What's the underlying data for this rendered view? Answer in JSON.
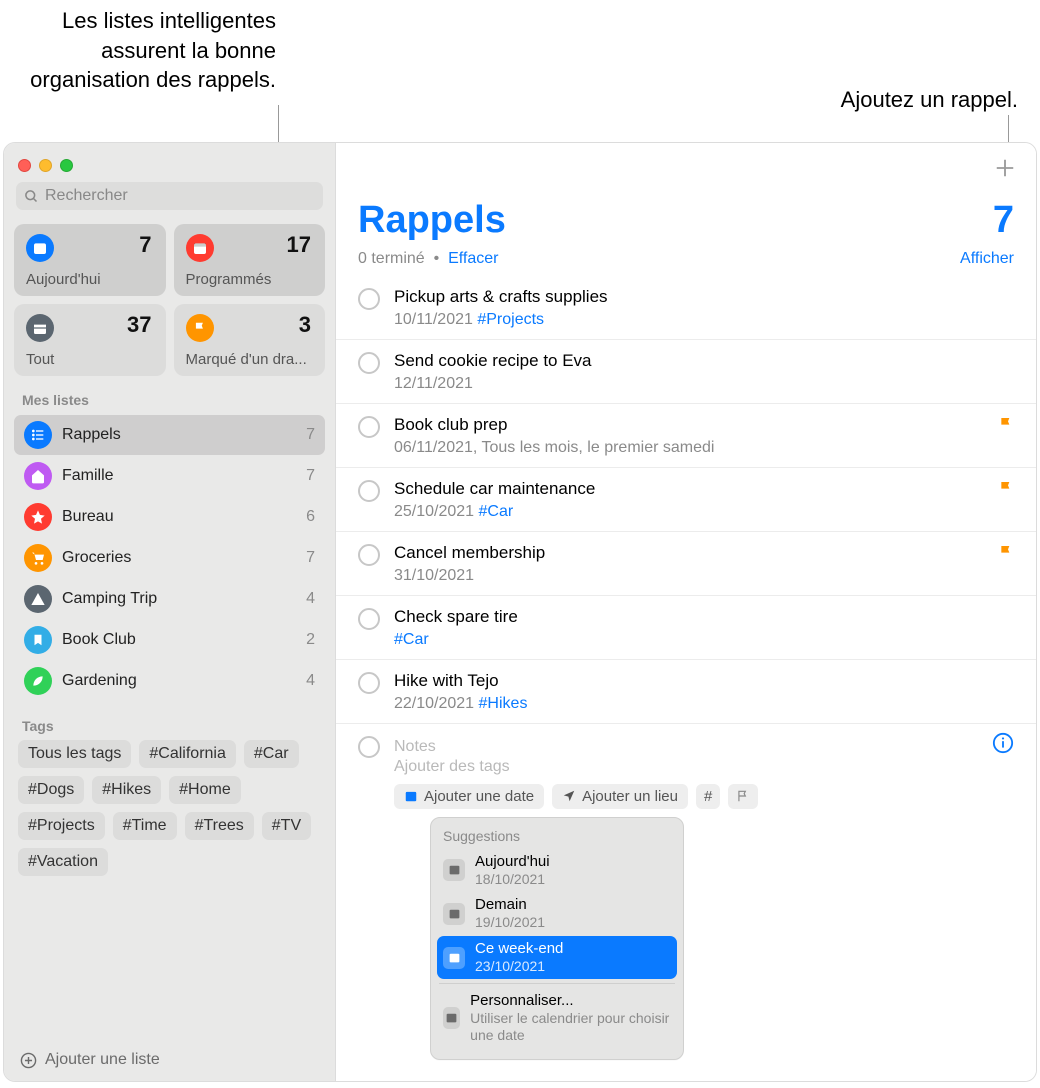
{
  "callouts": {
    "left": "Les listes intelligentes assurent la bonne organisation des rappels.",
    "right": "Ajoutez un rappel."
  },
  "search": {
    "placeholder": "Rechercher"
  },
  "smart": [
    {
      "id": "today",
      "label": "Aujourd'hui",
      "count": "7",
      "color": "#0a7aff"
    },
    {
      "id": "scheduled",
      "label": "Programmés",
      "count": "17",
      "color": "#ff3b30"
    },
    {
      "id": "all",
      "label": "Tout",
      "count": "37",
      "color": "#5b6670"
    },
    {
      "id": "flagged",
      "label": "Marqué d'un dra...",
      "count": "3",
      "color": "#ff9500"
    }
  ],
  "sections": {
    "lists": "Mes listes",
    "tags": "Tags"
  },
  "lists": [
    {
      "name": "Rappels",
      "count": "7",
      "color": "#0a7aff",
      "selected": true
    },
    {
      "name": "Famille",
      "count": "7",
      "color": "#bf5af2"
    },
    {
      "name": "Bureau",
      "count": "6",
      "color": "#ff3b30"
    },
    {
      "name": "Groceries",
      "count": "7",
      "color": "#ff9500"
    },
    {
      "name": "Camping Trip",
      "count": "4",
      "color": "#5b6670"
    },
    {
      "name": "Book Club",
      "count": "2",
      "color": "#32ade6"
    },
    {
      "name": "Gardening",
      "count": "4",
      "color": "#30d158"
    }
  ],
  "tags": [
    "Tous les tags",
    "#California",
    "#Car",
    "#Dogs",
    "#Hikes",
    "#Home",
    "#Projects",
    "#Time",
    "#Trees",
    "#TV",
    "#Vacation"
  ],
  "addList": "Ajouter une liste",
  "main": {
    "title": "Rappels",
    "count": "7",
    "completed": "0 terminé",
    "clear": "Effacer",
    "show": "Afficher"
  },
  "items": [
    {
      "title": "Pickup arts & crafts supplies",
      "sub": "10/11/2021",
      "hash": "#Projects"
    },
    {
      "title": "Send cookie recipe to Eva",
      "sub": "12/11/2021"
    },
    {
      "title": "Book club prep",
      "sub": "06/11/2021, Tous les mois, le premier samedi",
      "flag": true
    },
    {
      "title": "Schedule car maintenance",
      "sub": "25/10/2021",
      "hash": "#Car",
      "flag": true
    },
    {
      "title": "Cancel membership",
      "sub": "31/10/2021",
      "flag": true
    },
    {
      "title": "Check spare tire",
      "hash": "#Car"
    },
    {
      "title": "Hike with Tejo",
      "sub": "22/10/2021",
      "hash": "#Hikes"
    }
  ],
  "newItem": {
    "notes": "Notes",
    "addTags": "Ajouter des tags",
    "addDate": "Ajouter une date",
    "addLocation": "Ajouter un lieu"
  },
  "popover": {
    "title": "Suggestions",
    "items": [
      {
        "title": "Aujourd'hui",
        "date": "18/10/2021"
      },
      {
        "title": "Demain",
        "date": "19/10/2021"
      },
      {
        "title": "Ce week-end",
        "date": "23/10/2021",
        "selected": true
      },
      {
        "title": "Personnaliser...",
        "date": "Utiliser le calendrier pour choisir une date",
        "divider": true
      }
    ]
  }
}
